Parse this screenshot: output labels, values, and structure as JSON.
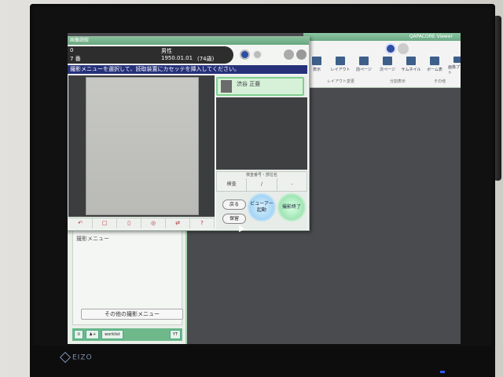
{
  "device": {
    "brand": "EIZO"
  },
  "viewer": {
    "title": "QAPACORE Viewer",
    "toolbar": [
      {
        "label": "表示",
        "icon": "view-icon"
      },
      {
        "label": "レイアウト",
        "icon": "layout-icon"
      },
      {
        "label": "前ページ",
        "icon": "prev-page-icon"
      },
      {
        "label": "次ページ",
        "icon": "next-page-icon"
      },
      {
        "label": "サムネイル",
        "icon": "thumbnail-icon"
      },
      {
        "label": "ボーム表",
        "icon": "tab-icon"
      },
      {
        "label": "画像プリント",
        "icon": "print-icon"
      }
    ],
    "sections": [
      "レイアウト変更",
      "分割表示",
      "その他"
    ]
  },
  "dialog": {
    "title": "画像読取",
    "patient": {
      "id": "0",
      "sex": "男性",
      "name": "7 番",
      "dob": "1950.01.01",
      "age": "(74歳)"
    },
    "message": "撮影メニューを選択して、読取装置にカセッテを挿入してください。",
    "patient_list_name": "渋谷 正亜",
    "grid_header": "検査番号・部位名",
    "grid_cells": [
      "検査",
      "/",
      "-"
    ],
    "buttons": {
      "cancel": "戻る",
      "hold": "保留",
      "viewer_start": "ビューアー起動",
      "finish": "撮影終了"
    },
    "tools": [
      "↶",
      "□",
      "▯",
      "◎",
      "⇄",
      "?"
    ]
  },
  "left_panel": {
    "menu_title": "撮影メニュー",
    "other_menu_button": "その他の撮影メニュー",
    "footer_buttons": [
      "①",
      "♟+",
      "worklist",
      "YT"
    ]
  }
}
